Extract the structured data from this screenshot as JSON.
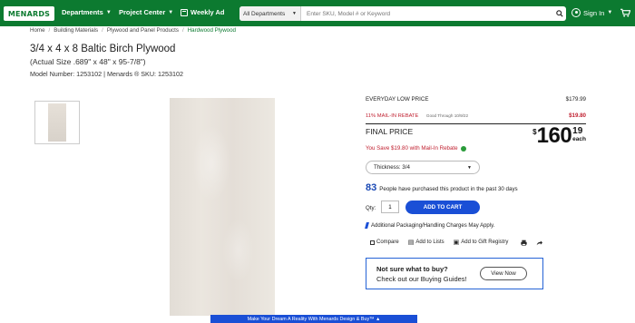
{
  "header": {
    "logo_text": "MENARDS",
    "nav": {
      "departments": "Departments",
      "project_center": "Project Center",
      "weekly_ad": "Weekly Ad"
    },
    "search": {
      "category": "All Departments",
      "placeholder": "Enter SKU, Model # or Keyword"
    },
    "sign_in": "Sign In"
  },
  "breadcrumb": [
    "Home",
    "Building Materials",
    "Plywood and Panel Products",
    "Hardwood Plywood"
  ],
  "product": {
    "title": "3/4 x 4 x 8 Baltic Birch Plywood",
    "subtitle": "(Actual Size .689\" x 48\" x 95-7/8\")",
    "model_line": "Model Number: 1253102",
    "sku_line": "Menards ® SKU: 1253102"
  },
  "pricing": {
    "everyday_label": "EVERYDAY LOW PRICE",
    "everyday_value": "$179.99",
    "rebate_label": "11% MAIL-IN REBATE",
    "rebate_through": "Good Through 10/9/22",
    "rebate_value": "$19.80",
    "final_label": "FINAL PRICE",
    "final_dollar": "$",
    "final_whole": "160",
    "final_cents": "19",
    "final_each": "each",
    "savings_text": "You Save $19.80 with Mail-In Rebate"
  },
  "options": {
    "thickness": "Thickness: 3/4"
  },
  "social_proof": {
    "count": "83",
    "text": "People have purchased this product in the past 30 days"
  },
  "cart": {
    "qty_label": "Qty:",
    "qty_value": "1",
    "add_label": "ADD TO CART"
  },
  "packaging_note": "Additional Packaging/Handling Charges May Apply.",
  "actions": {
    "compare": "Compare",
    "add_to_lists": "Add to Lists",
    "gift_registry": "Add to Gift Registry"
  },
  "guide": {
    "question": "Not sure what to buy?",
    "text": "Check out our Buying Guides!",
    "button": "View Now"
  },
  "banner": "Make Your Dream A Reality With Menards Design & Buy™ ▲",
  "colors": {
    "brand_green": "#0c7a30",
    "accent_blue": "#1a4fd6",
    "rebate_red": "#c01f2f"
  }
}
